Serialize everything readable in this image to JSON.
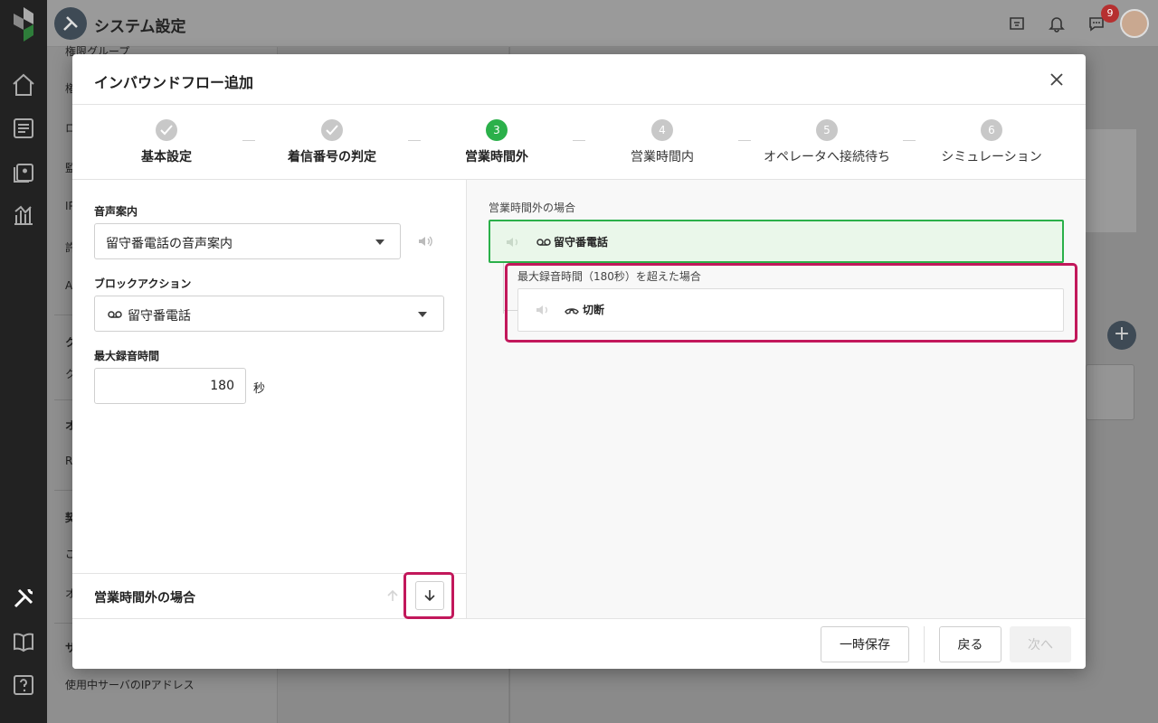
{
  "app": {
    "title": "システム設定",
    "notification_badge": "9"
  },
  "subnav": {
    "items": [
      "権限グループ",
      "権",
      "ロ",
      "監",
      "IP",
      "許",
      "A",
      "ク",
      "ク",
      "オ",
      "R",
      "契",
      "ご",
      "オ",
      "サ",
      "使用中サーバのIPアドレス"
    ]
  },
  "modal": {
    "title": "インバウンドフロー追加",
    "steps": [
      {
        "number": "1",
        "label": "基本設定",
        "state": "done"
      },
      {
        "number": "2",
        "label": "着信番号の判定",
        "state": "done"
      },
      {
        "number": "3",
        "label": "営業時間外",
        "state": "active"
      },
      {
        "number": "4",
        "label": "営業時間内",
        "state": "pending"
      },
      {
        "number": "5",
        "label": "オペレータへ接続待ち",
        "state": "pending"
      },
      {
        "number": "6",
        "label": "シミュレーション",
        "state": "pending"
      }
    ],
    "form": {
      "voice_label": "音声案内",
      "voice_value": "留守番電話の音声案内",
      "block_label": "ブロックアクション",
      "block_value": "留守番電話",
      "max_label": "最大録音時間",
      "max_value": "180",
      "max_unit": "秒"
    },
    "left_footer_title": "営業時間外の場合",
    "flow": {
      "section_label": "営業時間外の場合",
      "block1": "留守番電話",
      "branch_label": "最大録音時間（180秒）を超えた場合",
      "block2": "切断"
    },
    "buttons": {
      "save": "一時保存",
      "back": "戻る",
      "next": "次へ"
    }
  },
  "colors": {
    "accent": "#2bb04a",
    "highlight": "#c2185b"
  }
}
